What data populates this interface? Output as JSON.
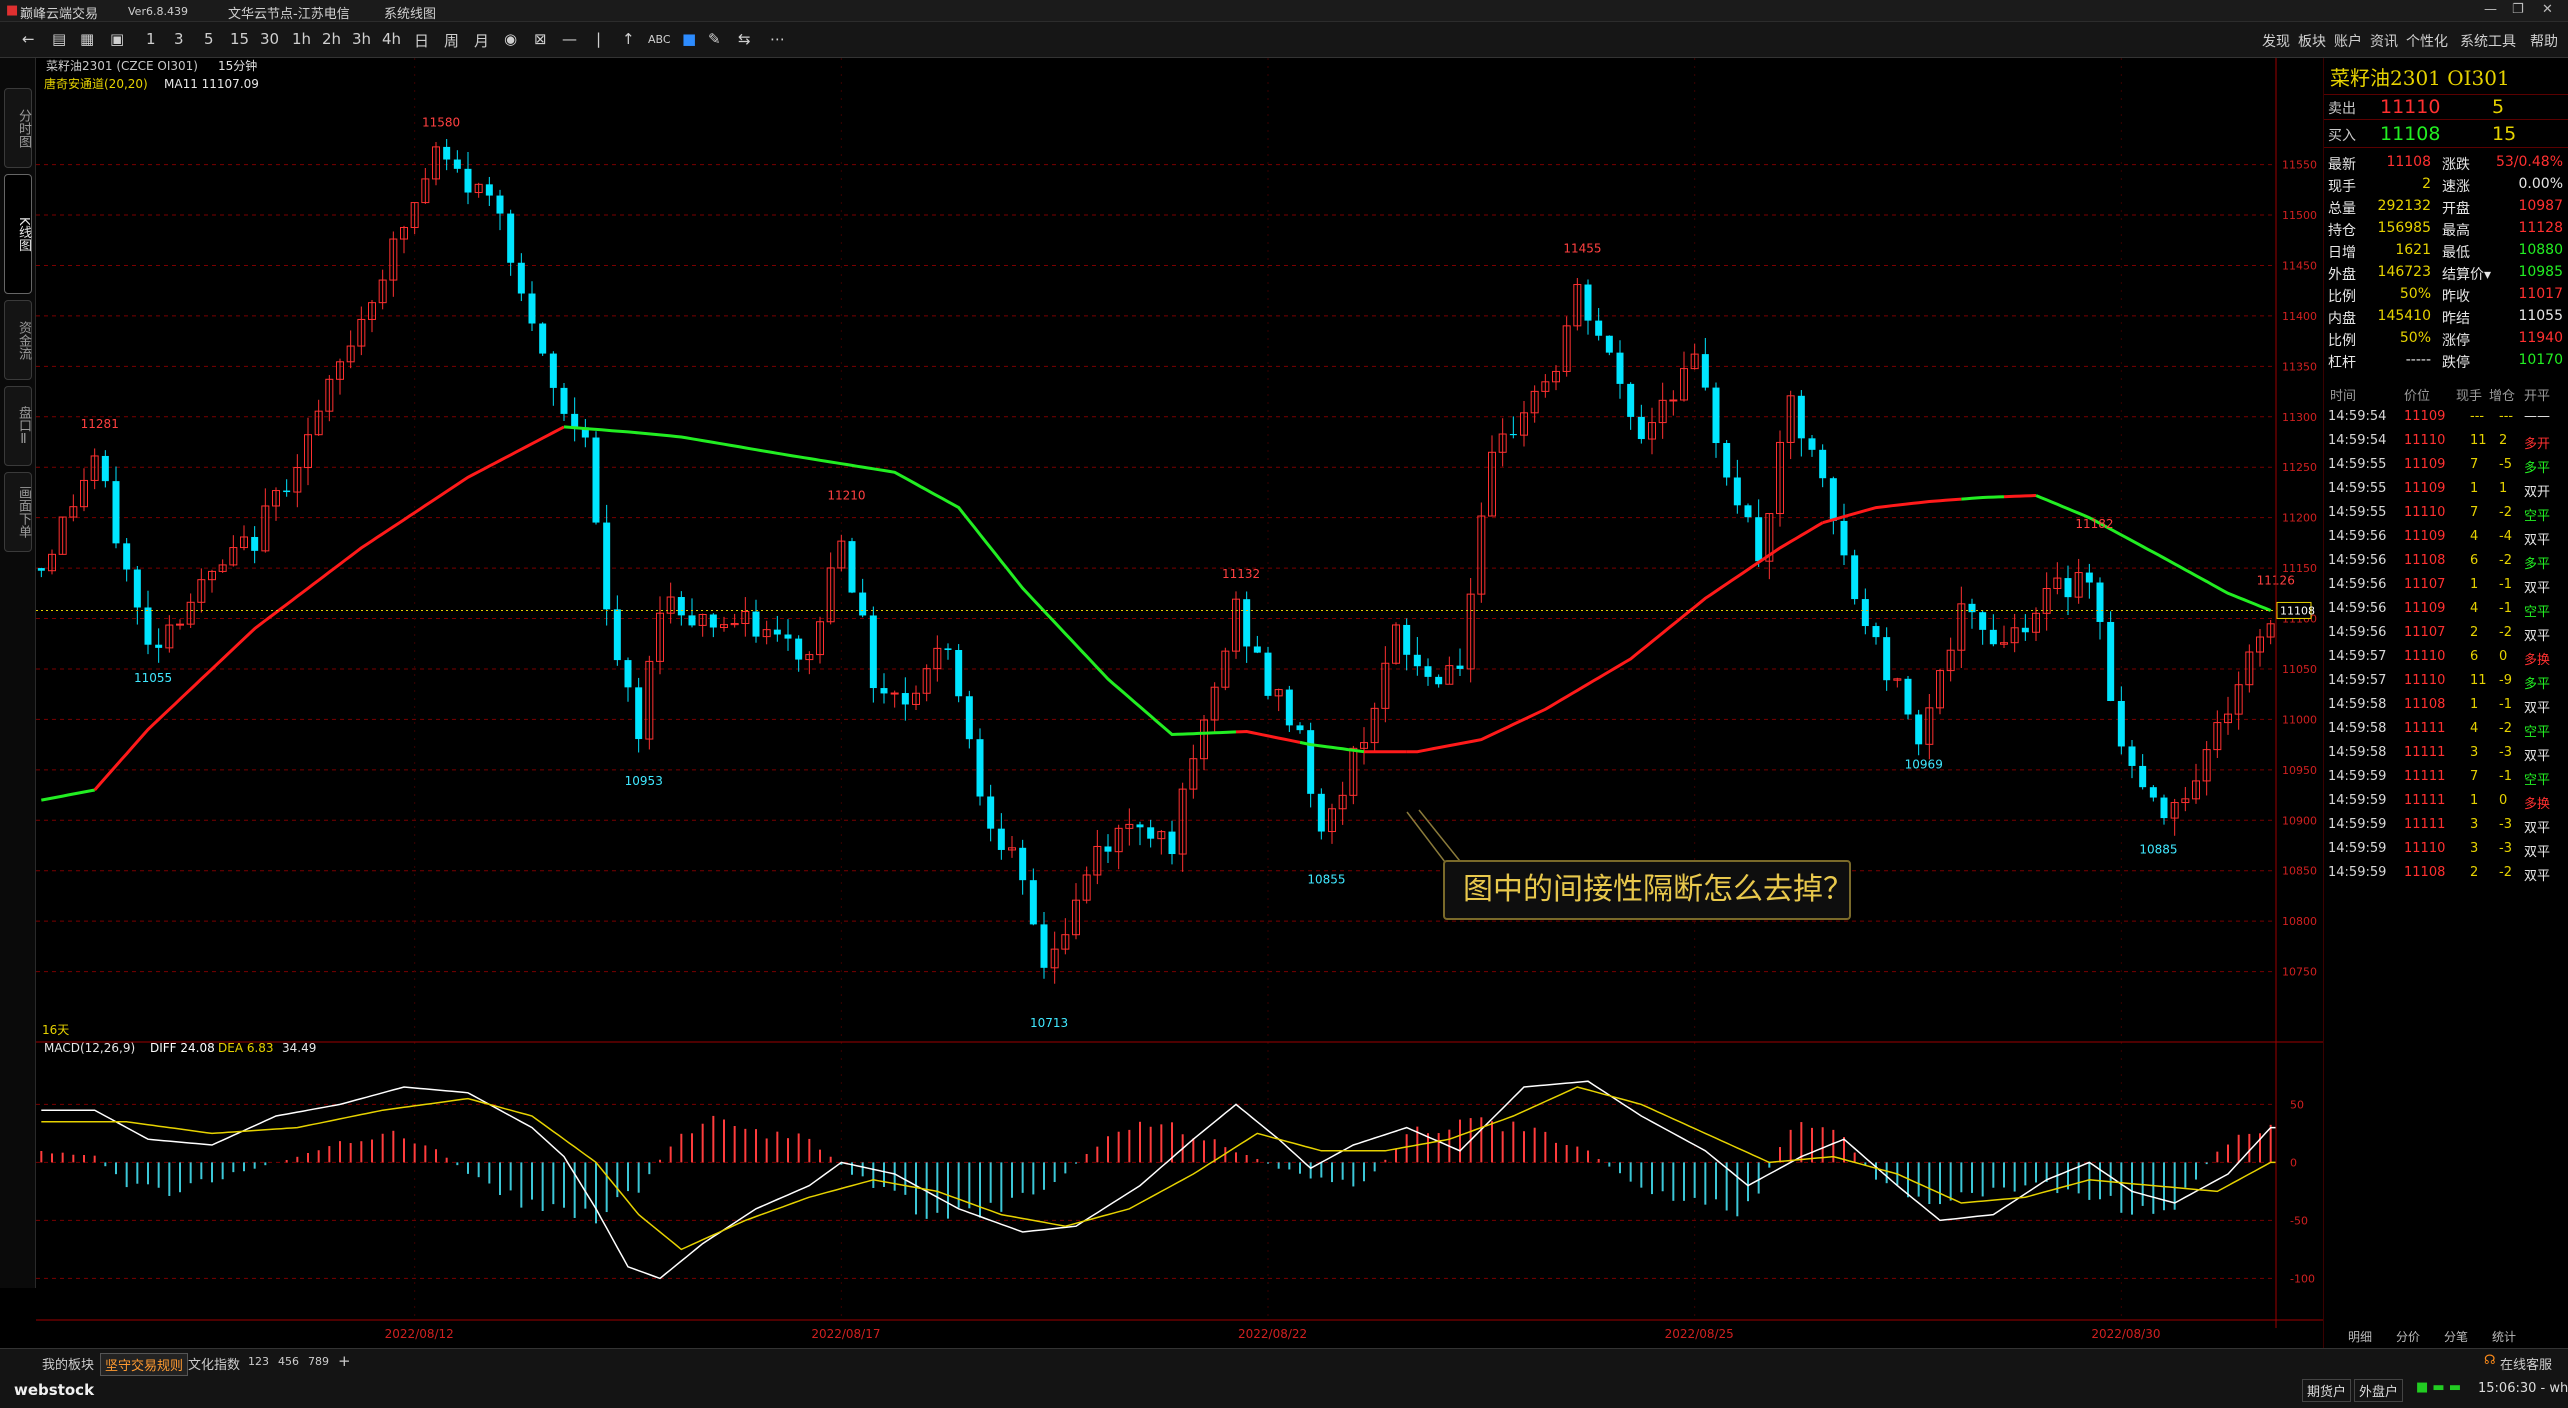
{
  "window": {
    "app_title": "巅峰云端交易",
    "version": "Ver6.8.439",
    "node": "文华云节点-江苏电信",
    "menu": "系统线图"
  },
  "toolbar": {
    "items": [
      "1",
      "3",
      "5",
      "15",
      "30",
      "1h",
      "2h",
      "3h",
      "4h",
      "日",
      "周",
      "月"
    ],
    "abc": "ABC",
    "right_menu": [
      "发现",
      "板块",
      "账户",
      "资讯",
      "个性化",
      "系统工具",
      "帮助"
    ]
  },
  "left_tabs": [
    "分时图",
    "K线图",
    "资金流",
    "盘口Ⅱ",
    "画面下单"
  ],
  "chart_header": {
    "symbol_line": "菜籽油2301 (CZCE OI301)",
    "period": "15分钟",
    "indicator_line": "唐奇安通道(20,20)",
    "ma_line": "MA11 11107.09"
  },
  "macd_header": {
    "name": "MACD(12,26,9)",
    "diff": "DIFF 24.08",
    "dea": "DEA 6.83",
    "macd": "34.49"
  },
  "subchart_label": "16天",
  "annotation": "图中的间接性隔断怎么去掉？",
  "colors": {
    "up": "#ff3030",
    "down": "#00e5ff",
    "ma_up": "#ff1a1a",
    "ma_down": "#22ee22",
    "macd_up": "#ff3c3c",
    "macd_down": "#3cc8d8",
    "diff": "#ffffff",
    "dea": "#e6d200",
    "grid": "#7a0000",
    "axis": "#9c0000",
    "price_line": "#e6d200"
  },
  "chart_data": {
    "type": "candlestick",
    "ylim": [
      10700,
      11620
    ],
    "yticks": [
      10750,
      10800,
      10850,
      10900,
      10950,
      11000,
      11050,
      11100,
      11150,
      11200,
      11250,
      11300,
      11350,
      11400,
      11450,
      11500,
      11550
    ],
    "last_price": 11108,
    "date_labels": [
      {
        "i": 35,
        "t": "2022/08/12"
      },
      {
        "i": 75,
        "t": "2022/08/17"
      },
      {
        "i": 115,
        "t": "2022/08/22"
      },
      {
        "i": 155,
        "t": "2022/08/25"
      },
      {
        "i": 195,
        "t": "2022/08/30"
      }
    ],
    "peaks": [
      {
        "i": 5,
        "v": 11281,
        "up": true
      },
      {
        "i": 10,
        "v": 11055,
        "up": false
      },
      {
        "i": 37,
        "v": 11580,
        "up": true
      },
      {
        "i": 56,
        "v": 10953,
        "up": false
      },
      {
        "i": 75,
        "v": 11210,
        "up": true
      },
      {
        "i": 94,
        "v": 10713,
        "up": false
      },
      {
        "i": 112,
        "v": 11132,
        "up": true
      },
      {
        "i": 120,
        "v": 10855,
        "up": false
      },
      {
        "i": 144,
        "v": 11455,
        "up": true
      },
      {
        "i": 176,
        "v": 10969,
        "up": false
      },
      {
        "i": 192,
        "v": 11182,
        "up": true
      },
      {
        "i": 198,
        "v": 10885,
        "up": false
      },
      {
        "i": 209,
        "v": 11126,
        "up": true
      }
    ],
    "anchors": [
      [
        0,
        11150
      ],
      [
        5,
        11260
      ],
      [
        10,
        11070
      ],
      [
        14,
        11120
      ],
      [
        20,
        11180
      ],
      [
        26,
        11300
      ],
      [
        30,
        11400
      ],
      [
        35,
        11510
      ],
      [
        37,
        11560
      ],
      [
        40,
        11530
      ],
      [
        43,
        11510
      ],
      [
        46,
        11380
      ],
      [
        49,
        11300
      ],
      [
        51,
        11290
      ],
      [
        53,
        11100
      ],
      [
        56,
        10980
      ],
      [
        58,
        11120
      ],
      [
        62,
        11100
      ],
      [
        67,
        11090
      ],
      [
        72,
        11060
      ],
      [
        75,
        11190
      ],
      [
        78,
        11040
      ],
      [
        81,
        11020
      ],
      [
        85,
        11080
      ],
      [
        88,
        10930
      ],
      [
        91,
        10860
      ],
      [
        94,
        10760
      ],
      [
        96,
        10790
      ],
      [
        99,
        10870
      ],
      [
        103,
        10900
      ],
      [
        106,
        10880
      ],
      [
        109,
        10990
      ],
      [
        112,
        11110
      ],
      [
        115,
        11030
      ],
      [
        118,
        10990
      ],
      [
        120,
        10880
      ],
      [
        123,
        10960
      ],
      [
        127,
        11080
      ],
      [
        130,
        11040
      ],
      [
        133,
        11060
      ],
      [
        136,
        11250
      ],
      [
        139,
        11310
      ],
      [
        142,
        11350
      ],
      [
        144,
        11420
      ],
      [
        146,
        11380
      ],
      [
        150,
        11280
      ],
      [
        152,
        11320
      ],
      [
        155,
        11350
      ],
      [
        158,
        11250
      ],
      [
        161,
        11160
      ],
      [
        164,
        11310
      ],
      [
        167,
        11230
      ],
      [
        170,
        11120
      ],
      [
        173,
        11050
      ],
      [
        176,
        10990
      ],
      [
        180,
        11100
      ],
      [
        184,
        11080
      ],
      [
        188,
        11120
      ],
      [
        192,
        11150
      ],
      [
        195,
        10970
      ],
      [
        198,
        10910
      ],
      [
        201,
        10930
      ],
      [
        204,
        10990
      ],
      [
        207,
        11060
      ],
      [
        209,
        11100
      ]
    ],
    "ma_points": [
      [
        0,
        10920
      ],
      [
        5,
        10930
      ],
      [
        10,
        10990
      ],
      [
        20,
        11090
      ],
      [
        30,
        11170
      ],
      [
        40,
        11240
      ],
      [
        49,
        11290
      ],
      [
        55,
        11285
      ],
      [
        60,
        11280
      ],
      [
        70,
        11262
      ],
      [
        80,
        11245
      ],
      [
        86,
        11210
      ],
      [
        92,
        11130
      ],
      [
        100,
        11040
      ],
      [
        106,
        10985
      ],
      [
        113,
        10988
      ],
      [
        119,
        10975
      ],
      [
        124,
        10968
      ],
      [
        129,
        10968
      ],
      [
        135,
        10980
      ],
      [
        141,
        11010
      ],
      [
        149,
        11060
      ],
      [
        156,
        11120
      ],
      [
        163,
        11170
      ],
      [
        167,
        11195
      ],
      [
        172,
        11210
      ],
      [
        177,
        11216
      ],
      [
        182,
        11220
      ],
      [
        187,
        11222
      ],
      [
        192,
        11200
      ],
      [
        199,
        11160
      ],
      [
        205,
        11125
      ],
      [
        209,
        11108
      ]
    ],
    "ma_colors": [
      [
        0,
        5,
        "green"
      ],
      [
        5,
        49,
        "red"
      ],
      [
        49,
        112,
        "green"
      ],
      [
        112,
        118,
        "red"
      ],
      [
        118,
        124,
        "green"
      ],
      [
        124,
        128,
        "red"
      ],
      [
        128,
        167,
        "red"
      ],
      [
        167,
        180,
        "red"
      ],
      [
        180,
        184,
        "green"
      ],
      [
        184,
        187,
        "red"
      ],
      [
        187,
        209,
        "green"
      ]
    ],
    "macd_yticks": [
      50,
      0,
      -50,
      -100
    ],
    "macd_ylim": [
      -110,
      90
    ],
    "macd_hist": [
      [
        0,
        10
      ],
      [
        5,
        5
      ],
      [
        8,
        -20
      ],
      [
        12,
        -25
      ],
      [
        18,
        -10
      ],
      [
        24,
        5
      ],
      [
        29,
        20
      ],
      [
        33,
        25
      ],
      [
        37,
        10
      ],
      [
        41,
        -15
      ],
      [
        45,
        -35
      ],
      [
        49,
        -40
      ],
      [
        52,
        -45
      ],
      [
        56,
        -25
      ],
      [
        60,
        30
      ],
      [
        64,
        35
      ],
      [
        68,
        25
      ],
      [
        72,
        20
      ],
      [
        76,
        -10
      ],
      [
        80,
        -30
      ],
      [
        84,
        -45
      ],
      [
        88,
        -45
      ],
      [
        92,
        -30
      ],
      [
        96,
        -10
      ],
      [
        100,
        25
      ],
      [
        104,
        35
      ],
      [
        108,
        25
      ],
      [
        112,
        10
      ],
      [
        116,
        -5
      ],
      [
        120,
        -15
      ],
      [
        124,
        -20
      ],
      [
        128,
        25
      ],
      [
        132,
        30
      ],
      [
        136,
        35
      ],
      [
        140,
        25
      ],
      [
        144,
        15
      ],
      [
        148,
        -10
      ],
      [
        152,
        -30
      ],
      [
        156,
        -35
      ],
      [
        160,
        -40
      ],
      [
        164,
        30
      ],
      [
        168,
        35
      ],
      [
        172,
        -15
      ],
      [
        176,
        -30
      ],
      [
        180,
        -30
      ],
      [
        184,
        -25
      ],
      [
        188,
        -20
      ],
      [
        192,
        -30
      ],
      [
        196,
        -40
      ],
      [
        200,
        -35
      ],
      [
        204,
        10
      ],
      [
        208,
        30
      ],
      [
        209,
        34
      ]
    ],
    "macd_diff": [
      [
        0,
        45
      ],
      [
        5,
        45
      ],
      [
        10,
        20
      ],
      [
        16,
        15
      ],
      [
        22,
        40
      ],
      [
        28,
        50
      ],
      [
        34,
        65
      ],
      [
        40,
        60
      ],
      [
        46,
        30
      ],
      [
        49,
        5
      ],
      [
        52,
        -40
      ],
      [
        55,
        -90
      ],
      [
        58,
        -100
      ],
      [
        62,
        -70
      ],
      [
        67,
        -40
      ],
      [
        72,
        -20
      ],
      [
        75,
        0
      ],
      [
        80,
        -10
      ],
      [
        86,
        -40
      ],
      [
        92,
        -60
      ],
      [
        97,
        -55
      ],
      [
        103,
        -20
      ],
      [
        108,
        20
      ],
      [
        112,
        50
      ],
      [
        116,
        20
      ],
      [
        119,
        -5
      ],
      [
        123,
        15
      ],
      [
        128,
        30
      ],
      [
        133,
        10
      ],
      [
        139,
        65
      ],
      [
        145,
        70
      ],
      [
        150,
        40
      ],
      [
        156,
        10
      ],
      [
        160,
        -20
      ],
      [
        165,
        5
      ],
      [
        169,
        20
      ],
      [
        174,
        -20
      ],
      [
        178,
        -50
      ],
      [
        183,
        -45
      ],
      [
        188,
        -15
      ],
      [
        192,
        0
      ],
      [
        196,
        -25
      ],
      [
        200,
        -35
      ],
      [
        205,
        -10
      ],
      [
        209,
        30
      ]
    ],
    "macd_dea": [
      [
        0,
        35
      ],
      [
        8,
        35
      ],
      [
        16,
        25
      ],
      [
        24,
        30
      ],
      [
        32,
        45
      ],
      [
        40,
        55
      ],
      [
        46,
        40
      ],
      [
        52,
        0
      ],
      [
        56,
        -45
      ],
      [
        60,
        -75
      ],
      [
        66,
        -50
      ],
      [
        72,
        -30
      ],
      [
        78,
        -15
      ],
      [
        84,
        -25
      ],
      [
        90,
        -45
      ],
      [
        96,
        -55
      ],
      [
        102,
        -40
      ],
      [
        108,
        -10
      ],
      [
        114,
        25
      ],
      [
        120,
        10
      ],
      [
        126,
        10
      ],
      [
        132,
        20
      ],
      [
        138,
        40
      ],
      [
        144,
        65
      ],
      [
        150,
        50
      ],
      [
        156,
        25
      ],
      [
        162,
        0
      ],
      [
        168,
        5
      ],
      [
        174,
        -10
      ],
      [
        180,
        -35
      ],
      [
        186,
        -30
      ],
      [
        192,
        -15
      ],
      [
        198,
        -20
      ],
      [
        204,
        -25
      ],
      [
        209,
        0
      ]
    ]
  },
  "quote": {
    "title": "菜籽油2301  OI301",
    "ask": {
      "label": "卖出",
      "price": "11110",
      "vol": "5"
    },
    "bid": {
      "label": "买入",
      "price": "11108",
      "vol": "15"
    },
    "rows": [
      [
        "最新",
        "11108",
        "涨跌",
        "53/0.48%"
      ],
      [
        "现手",
        "2",
        "速涨",
        "0.00%"
      ],
      [
        "总量",
        "292132",
        "开盘",
        "10987"
      ],
      [
        "持仓",
        "156985",
        "最高",
        "11128"
      ],
      [
        "日增",
        "1621",
        "最低",
        "10880"
      ],
      [
        "外盘",
        "146723",
        "结算价▾",
        "10985"
      ],
      [
        "比例",
        "50%",
        "昨收",
        "11017"
      ],
      [
        "内盘",
        "145410",
        "昨结",
        "11055"
      ],
      [
        "比例",
        "50%",
        "涨停",
        "11940"
      ],
      [
        "杠杆",
        "-----",
        "跌停",
        "10170"
      ]
    ],
    "detail_headers": [
      "时间",
      "价位",
      "现手",
      "增仓",
      "开平"
    ],
    "details": [
      [
        "14:59:54",
        "11109",
        "---",
        "---",
        "——"
      ],
      [
        "14:59:54",
        "11110",
        "11",
        "2",
        "多开"
      ],
      [
        "14:59:55",
        "11109",
        "7",
        "-5",
        "多平"
      ],
      [
        "14:59:55",
        "11109",
        "1",
        "1",
        "双开"
      ],
      [
        "14:59:55",
        "11110",
        "7",
        "-2",
        "空平"
      ],
      [
        "14:59:56",
        "11109",
        "4",
        "-4",
        "双平"
      ],
      [
        "14:59:56",
        "11108",
        "6",
        "-2",
        "多平"
      ],
      [
        "14:59:56",
        "11107",
        "1",
        "-1",
        "双平"
      ],
      [
        "14:59:56",
        "11109",
        "4",
        "-1",
        "空平"
      ],
      [
        "14:59:56",
        "11107",
        "2",
        "-2",
        "双平"
      ],
      [
        "14:59:57",
        "11110",
        "6",
        "0",
        "多换"
      ],
      [
        "14:59:57",
        "11110",
        "11",
        "-9",
        "多平"
      ],
      [
        "14:59:58",
        "11108",
        "1",
        "-1",
        "双平"
      ],
      [
        "14:59:58",
        "11111",
        "4",
        "-2",
        "空平"
      ],
      [
        "14:59:58",
        "11111",
        "3",
        "-3",
        "双平"
      ],
      [
        "14:59:59",
        "11111",
        "7",
        "-1",
        "空平"
      ],
      [
        "14:59:59",
        "11111",
        "1",
        "0",
        "多换"
      ],
      [
        "14:59:59",
        "11111",
        "3",
        "-3",
        "双平"
      ],
      [
        "14:59:59",
        "11110",
        "3",
        "-3",
        "双平"
      ],
      [
        "14:59:59",
        "11108",
        "2",
        "-2",
        "双平"
      ]
    ],
    "bottom_tabs": [
      "明细",
      "分价",
      "分笔",
      "统计"
    ]
  },
  "statusbar": {
    "tabs": [
      "我的板块",
      "坚守交易规则",
      "文化指数",
      "123",
      "456",
      "789",
      "+"
    ],
    "logo": "webstock",
    "online": "在线客服",
    "time": "15:06:30 - wh",
    "buttons": [
      "期货户",
      "外盘户"
    ]
  }
}
